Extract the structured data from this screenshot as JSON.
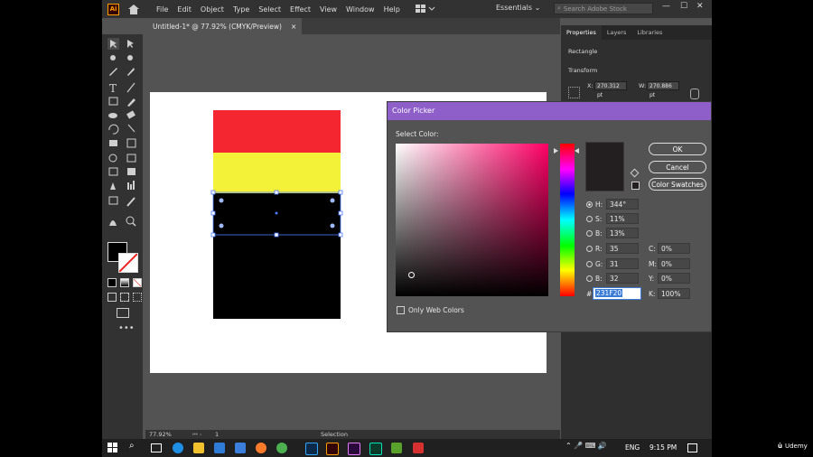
{
  "app": {
    "logo_text": "Ai"
  },
  "menu": [
    "File",
    "Edit",
    "Object",
    "Type",
    "Select",
    "Effect",
    "View",
    "Window",
    "Help"
  ],
  "workspace": {
    "label": "Essentials",
    "search_placeholder": "Search Adobe Stock"
  },
  "window_controls": {
    "minimize": "—",
    "maximize": "☐",
    "close": "✕"
  },
  "document": {
    "tab_title": "Untitled-1* @ 77.92% (CMYK/Preview)",
    "close": "×"
  },
  "status": {
    "zoom": "77.92%",
    "page": "1",
    "tool": "Selection"
  },
  "panel": {
    "tabs": [
      "Properties",
      "Layers",
      "Libraries"
    ],
    "section": "Rectangle",
    "transform_label": "Transform",
    "x_label": "X:",
    "x_value": "270.312 pt",
    "w_label": "W:",
    "w_value": "270.886 pt"
  },
  "picker": {
    "title": "Color Picker",
    "select_label": "Select Color:",
    "only_web": "Only Web Colors",
    "buttons": {
      "ok": "OK",
      "cancel": "Cancel",
      "swatches": "Color Swatches"
    },
    "hsb": [
      {
        "label": "H:",
        "value": "344°",
        "selected": true
      },
      {
        "label": "S:",
        "value": "11%"
      },
      {
        "label": "B:",
        "value": "13%"
      }
    ],
    "rgb": [
      {
        "label": "R:",
        "value": "35"
      },
      {
        "label": "G:",
        "value": "31"
      },
      {
        "label": "B:",
        "value": "32"
      }
    ],
    "cmyk": [
      {
        "label": "C:",
        "value": "0%"
      },
      {
        "label": "M:",
        "value": "0%"
      },
      {
        "label": "Y:",
        "value": "0%"
      },
      {
        "label": "K:",
        "value": "100%"
      }
    ],
    "hex_label": "#",
    "hex": "231F20",
    "hue_level": 0.05,
    "selected_color": "#231f20"
  },
  "artwork_colors": {
    "red": "#f4262f",
    "yellow": "#f4f139",
    "black": "#000000"
  },
  "taskbar": {
    "lang": "ENG",
    "time": "9:15 PM",
    "watermark": "Udemy"
  }
}
